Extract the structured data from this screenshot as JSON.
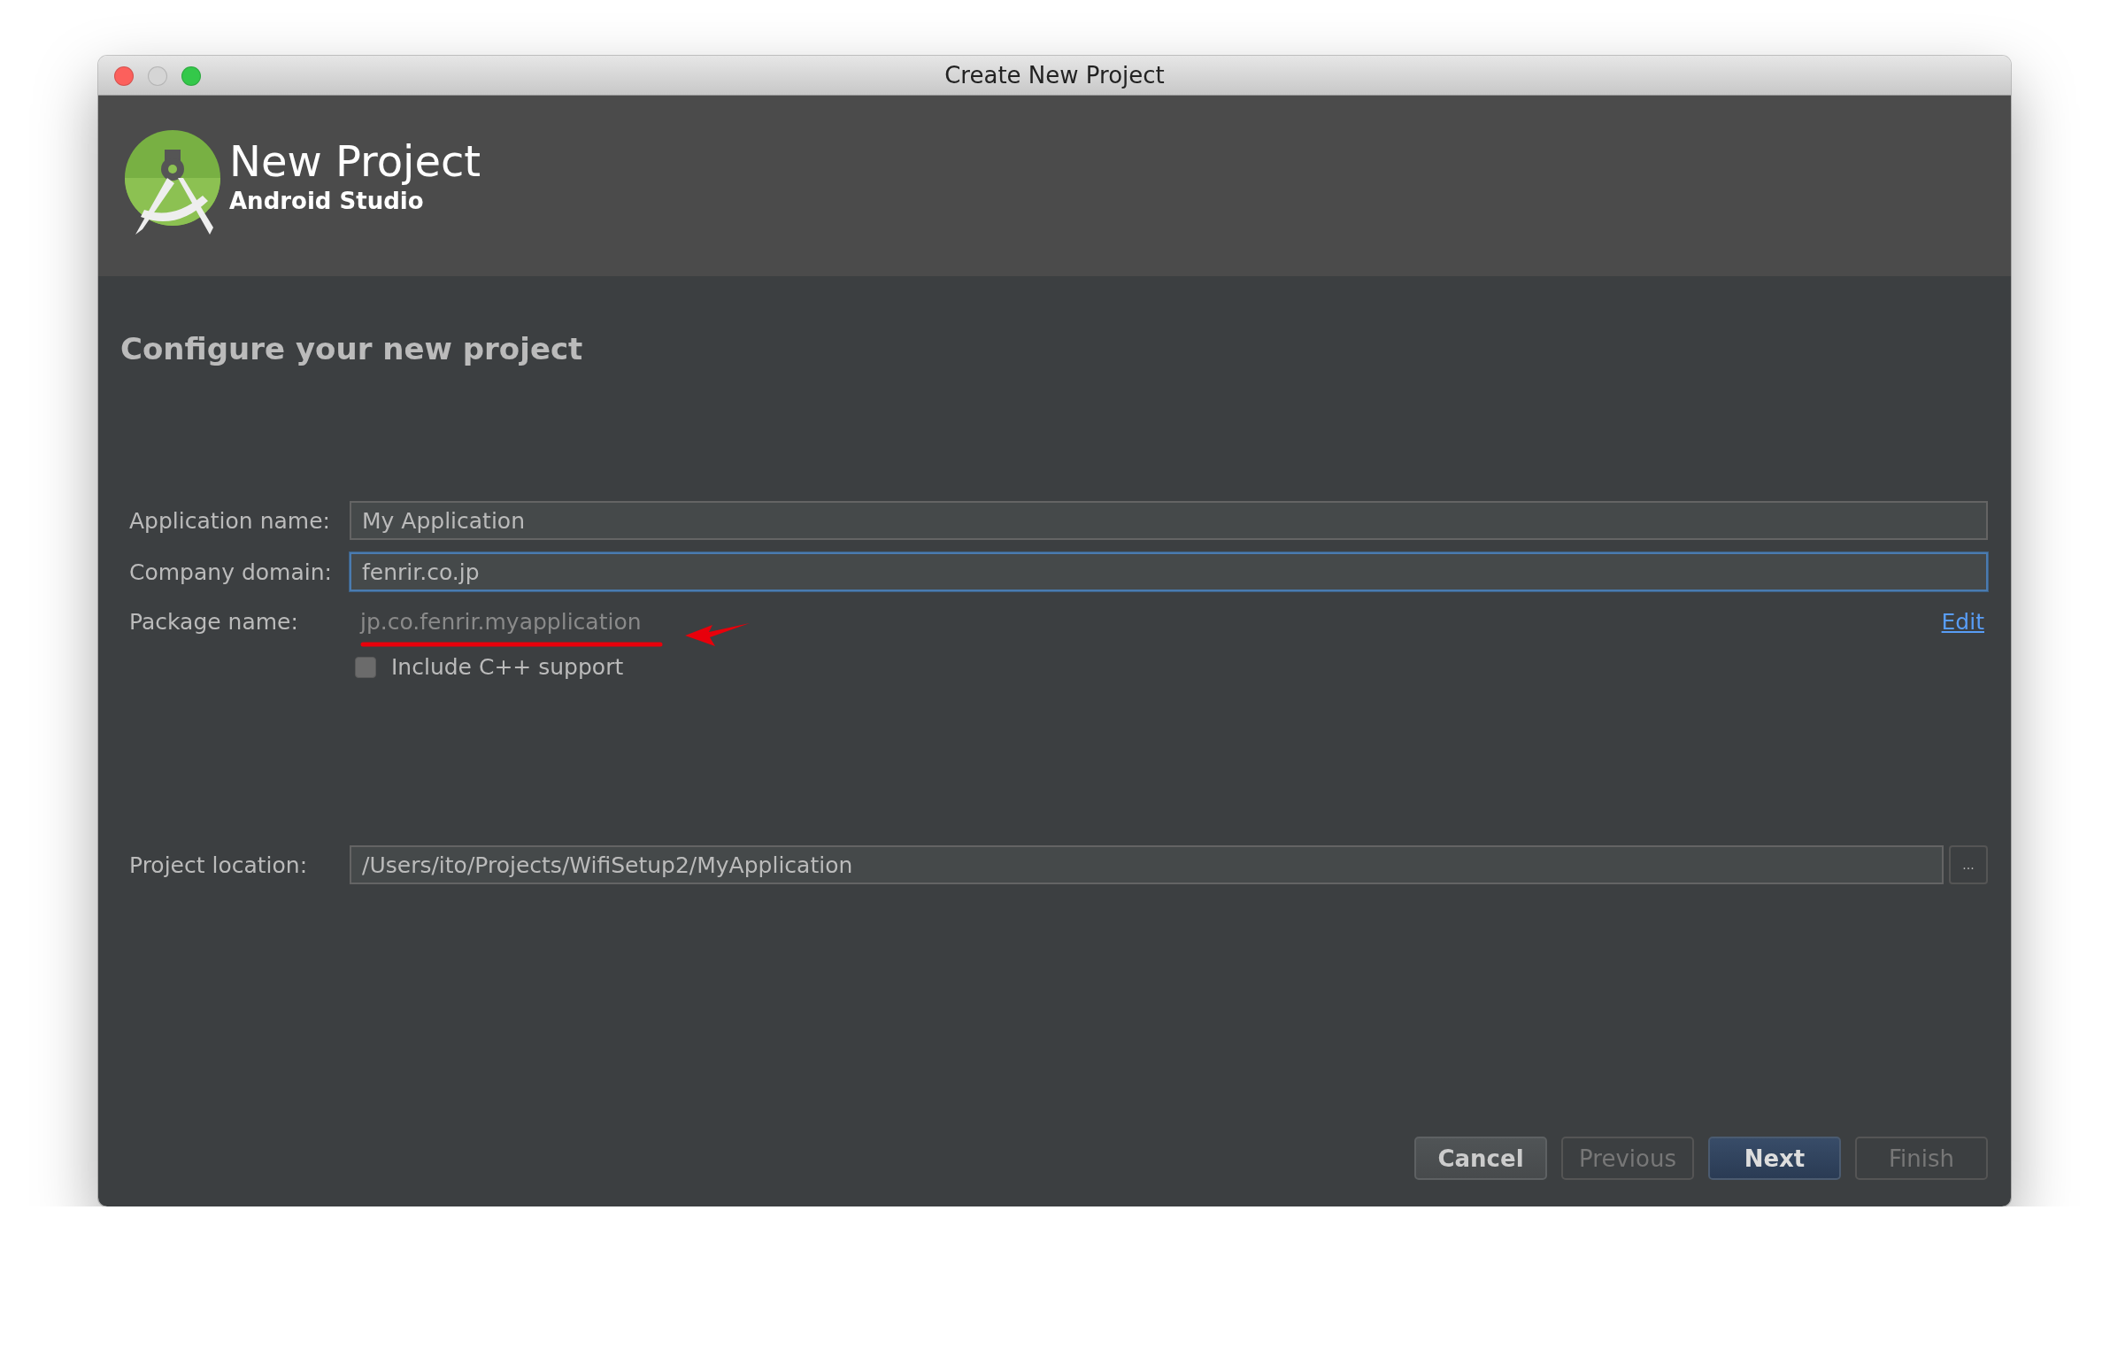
{
  "window": {
    "title": "Create New Project"
  },
  "header": {
    "title": "New Project",
    "subtitle": "Android Studio"
  },
  "page_title": "Configure your new project",
  "fields": [
    {
      "label": "Application name:",
      "value": "My Application",
      "focused": false
    },
    {
      "label": "Company domain:",
      "value": "fenrir.co.jp",
      "focused": true
    }
  ],
  "package": {
    "label": "Package name:",
    "value": "jp.co.fenrir.myapplication",
    "link": "Edit"
  },
  "cpp_support": {
    "label": "Include C++ support",
    "checked": false
  },
  "location": {
    "label": "Project location:",
    "value": "/Users/ito/Projects/WifiSetup2/MyApplication",
    "browse": "..."
  },
  "buttons": [
    {
      "label": "Cancel",
      "kind": "normal",
      "disabled": false
    },
    {
      "label": "Previous",
      "kind": "normal",
      "disabled": true
    },
    {
      "label": "Next",
      "kind": "default",
      "disabled": false
    },
    {
      "label": "Finish",
      "kind": "normal",
      "disabled": true
    }
  ]
}
